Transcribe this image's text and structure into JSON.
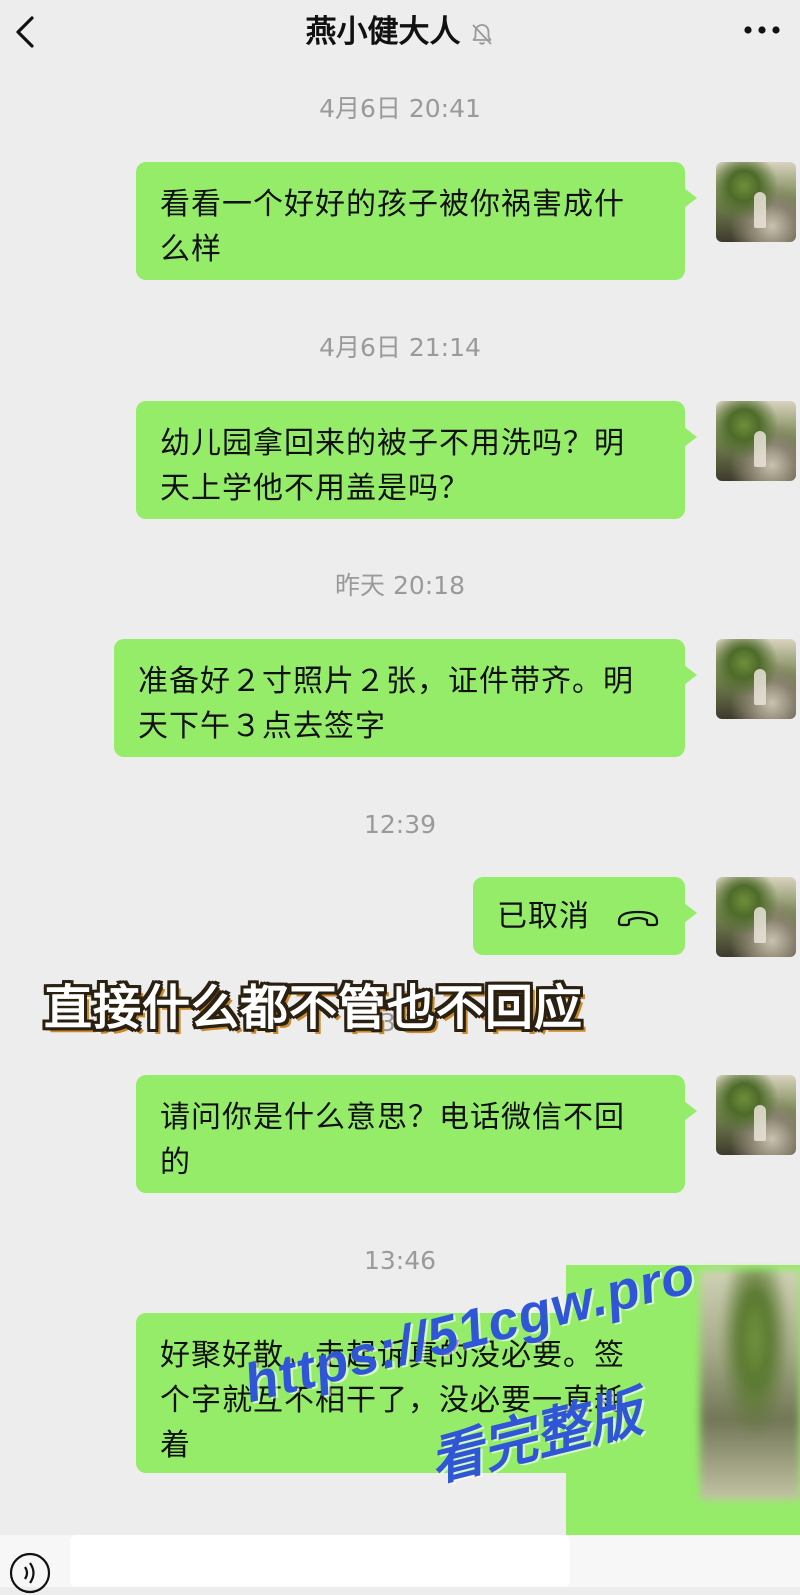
{
  "header": {
    "title": "燕小健大人",
    "back_icon": "chevron-left-icon",
    "mute_icon": "bell-off-icon",
    "more_icon": "more-dots-icon"
  },
  "messages": [
    {
      "timestamp": "4月6日 20:41",
      "line1": "看看一个好好的孩子被你祸害成什",
      "line2": "么样"
    },
    {
      "timestamp": "4月6日 21:14",
      "line1": "幼儿园拿回来的被子不用洗吗？明",
      "line2": "天上学他不用盖是吗？"
    },
    {
      "timestamp": "昨天 20:18",
      "line1": "准备好２寸照片２张，证件带齐。明",
      "line2": "天下午３点去签字"
    },
    {
      "timestamp": "12:39",
      "call_label": "已取消"
    },
    {
      "timestamp_partial": "13:26",
      "line1": "请问你是什么意思？电话微信不回",
      "line2": "的"
    },
    {
      "timestamp": "13:46",
      "line1": "好聚好散，走起诉真的没必要。签",
      "line2": "个字就互不相干了，没必要一直耗",
      "line3": "着"
    }
  ],
  "overlay": {
    "caption": "直接什么都不管也不回应"
  },
  "watermark": {
    "line1": "https://51cgw.pro",
    "line2": "看完整版"
  },
  "colors": {
    "bubble": "#95ec69",
    "background": "#ededed",
    "timestamp": "#9a9a9a",
    "watermark": "#2f56d6"
  }
}
